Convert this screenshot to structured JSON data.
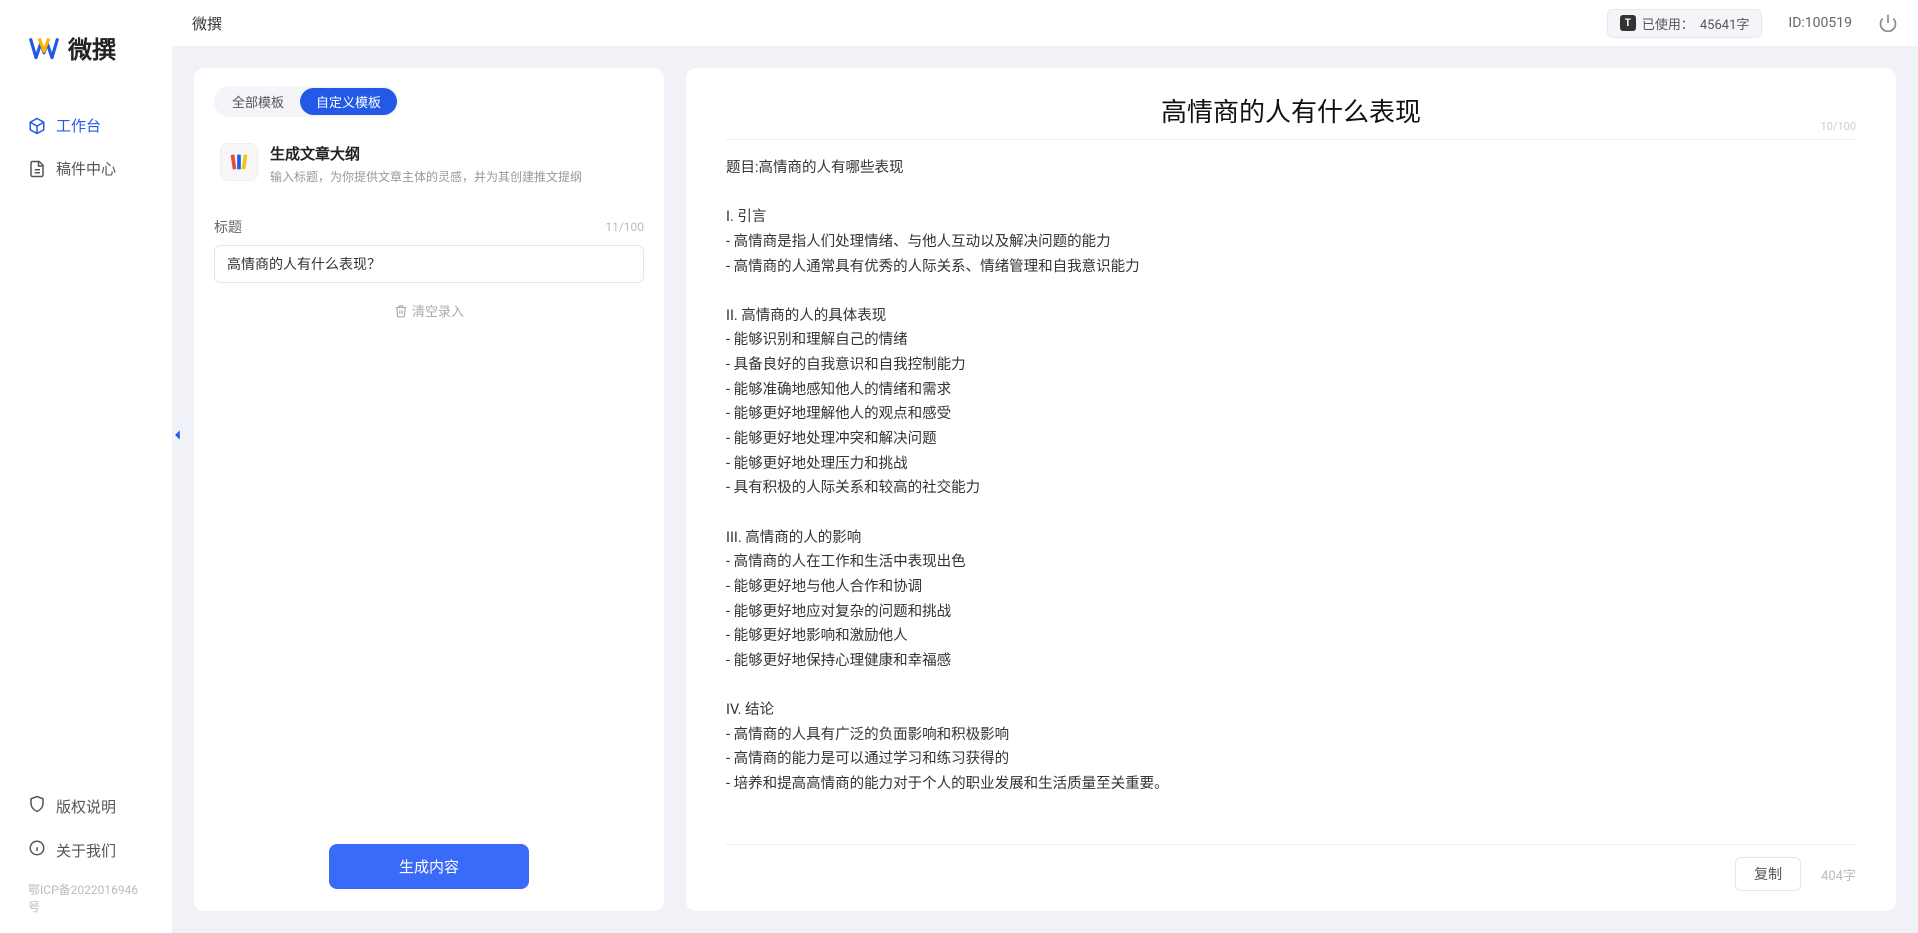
{
  "brand": {
    "name": "微撰"
  },
  "sidebar": {
    "nav": [
      {
        "label": "工作台",
        "active": true
      },
      {
        "label": "稿件中心",
        "active": false
      }
    ],
    "bottom": [
      {
        "label": "版权说明"
      },
      {
        "label": "关于我们"
      }
    ],
    "icp": "鄂ICP备2022016946号"
  },
  "topbar": {
    "title": "微撰",
    "usage_prefix": "已使用：",
    "usage_value": "45641字",
    "id_label": "ID:100519"
  },
  "left_panel": {
    "tabs": {
      "all": "全部模板",
      "custom": "自定义模板"
    },
    "template": {
      "title": "生成文章大纲",
      "subtitle": "输入标题，为你提供文章主体的灵感，并为其创建推文提纲"
    },
    "title_label": "标题",
    "title_counter": "11/100",
    "title_value": "高情商的人有什么表现？",
    "clear_label": "清空录入",
    "generate_label": "生成内容"
  },
  "right_panel": {
    "doc_title": "高情商的人有什么表现",
    "head_counter": "10/100",
    "body": "题目:高情商的人有哪些表现\n\nI. 引言\n- 高情商是指人们处理情绪、与他人互动以及解决问题的能力\n- 高情商的人通常具有优秀的人际关系、情绪管理和自我意识能力\n\nII. 高情商的人的具体表现\n- 能够识别和理解自己的情绪\n- 具备良好的自我意识和自我控制能力\n- 能够准确地感知他人的情绪和需求\n- 能够更好地理解他人的观点和感受\n- 能够更好地处理冲突和解决问题\n- 能够更好地处理压力和挑战\n- 具有积极的人际关系和较高的社交能力\n\nIII. 高情商的人的影响\n- 高情商的人在工作和生活中表现出色\n- 能够更好地与他人合作和协调\n- 能够更好地应对复杂的问题和挑战\n- 能够更好地影响和激励他人\n- 能够更好地保持心理健康和幸福感\n\nIV. 结论\n- 高情商的人具有广泛的负面影响和积极影响\n- 高情商的能力是可以通过学习和练习获得的\n- 培养和提高高情商的能力对于个人的职业发展和生活质量至关重要。",
    "copy_label": "复制",
    "word_count": "404字"
  }
}
